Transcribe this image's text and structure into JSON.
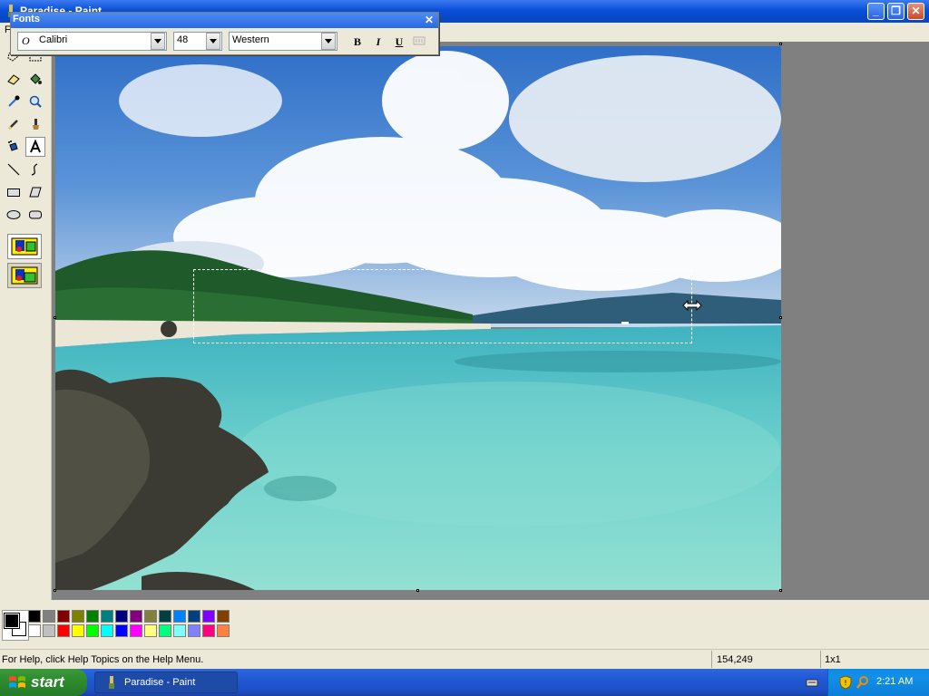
{
  "window": {
    "title": "Paradise - Paint",
    "controls": {
      "minimize": "_",
      "restore": "❐",
      "close": "✕"
    }
  },
  "menu": {
    "visible_items": [
      "F"
    ]
  },
  "fonts_toolbar": {
    "title": "Fonts",
    "close": "✕",
    "font_name": "Calibri",
    "font_size": "48",
    "script": "Western",
    "bold": "B",
    "italic": "I",
    "underline": "U"
  },
  "palette": {
    "foreground": "#000000",
    "background": "#ffffff",
    "row1": [
      "#000000",
      "#808080",
      "#800000",
      "#808000",
      "#008000",
      "#008080",
      "#000080",
      "#800080",
      "#808040",
      "#004040",
      "#0080ff",
      "#004080",
      "#8000ff",
      "#804000"
    ],
    "row2": [
      "#ffffff",
      "#c0c0c0",
      "#ff0000",
      "#ffff00",
      "#00ff00",
      "#00ffff",
      "#0000ff",
      "#ff00ff",
      "#ffff80",
      "#00ff80",
      "#80ffff",
      "#8080ff",
      "#ff0080",
      "#ff8040"
    ]
  },
  "status": {
    "help": "For Help, click Help Topics on the Help Menu.",
    "coords": "154,249",
    "size": "1x1"
  },
  "taskbar": {
    "start": "start",
    "task": "Paradise - Paint",
    "clock": "2:21 AM"
  },
  "tools": [
    "free-select",
    "select",
    "eraser",
    "fill",
    "color-picker",
    "magnifier",
    "pencil",
    "brush",
    "airbrush",
    "text",
    "line",
    "curve",
    "rectangle",
    "polygon",
    "ellipse",
    "rounded-rectangle"
  ]
}
